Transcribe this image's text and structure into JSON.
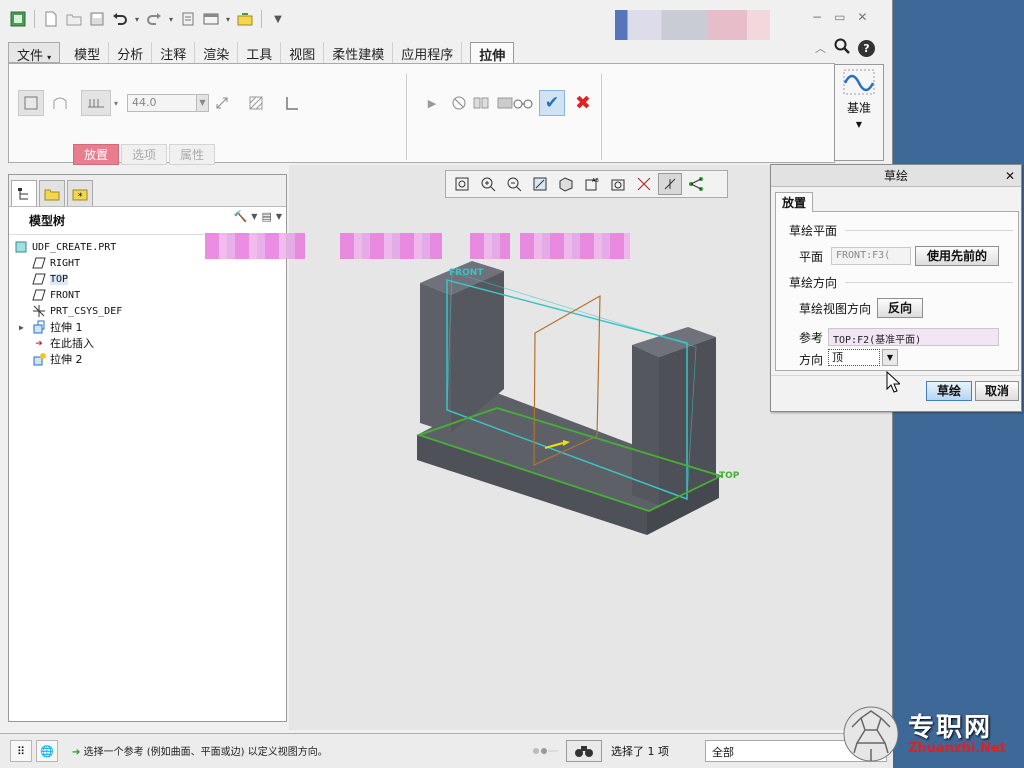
{
  "quick_access": {
    "icons": [
      "app-icon",
      "new-icon",
      "open-icon",
      "save-icon",
      "undo-icon",
      "redo-icon",
      "regenerate-icon",
      "windows-icon",
      "close-icon",
      "customize-icon"
    ]
  },
  "ribbon": {
    "tabs": [
      {
        "label": "文件"
      },
      {
        "label": "模型"
      },
      {
        "label": "分析"
      },
      {
        "label": "注释"
      },
      {
        "label": "渲染"
      },
      {
        "label": "工具"
      },
      {
        "label": "视图"
      },
      {
        "label": "柔性建模"
      },
      {
        "label": "应用程序"
      },
      {
        "label": "拉伸"
      }
    ],
    "active_tab": "拉伸",
    "depth_value": "44.0",
    "subtabs": [
      {
        "label": "放置"
      },
      {
        "label": "选项"
      },
      {
        "label": "属性"
      }
    ],
    "datum_label": "基准"
  },
  "model_tree": {
    "header": "模型树",
    "items": [
      {
        "label": "UDF_CREATE.PRT",
        "icon": "part-icon"
      },
      {
        "label": "RIGHT",
        "icon": "datum-plane-icon"
      },
      {
        "label": "TOP",
        "icon": "datum-plane-icon"
      },
      {
        "label": "FRONT",
        "icon": "datum-plane-icon"
      },
      {
        "label": "PRT_CSYS_DEF",
        "icon": "csys-icon"
      },
      {
        "label": "拉伸 1",
        "icon": "extrude-icon"
      },
      {
        "label": "在此插入",
        "icon": "insert-arrow-icon"
      },
      {
        "label": "拉伸 2",
        "icon": "extrude-new-icon"
      }
    ]
  },
  "viewport": {
    "labels": {
      "front": "FRONT",
      "top": "TOP"
    }
  },
  "sketch_dialog": {
    "title": "草绘",
    "tab": "放置",
    "plane_group": "草绘平面",
    "plane_label": "平面",
    "plane_value": "FRONT:F3(",
    "use_previous_button": "使用先前的",
    "orientation_group": "草绘方向",
    "view_direction_label": "草绘视图方向",
    "flip_button": "反向",
    "reference_label": "参考",
    "reference_value": "TOP:F2(基准平面)",
    "direction_label": "方向",
    "direction_value": "顶",
    "sketch_button": "草绘",
    "cancel_button": "取消"
  },
  "status_bar": {
    "message": "选择一个参考 (例如曲面、平面或边) 以定义视图方向。",
    "selection_count": "选择了 1 项",
    "filter_value": "全部"
  },
  "watermark": {
    "cn": "专职网",
    "en": "Zhuanzhi.Net"
  },
  "colors": {
    "accent_subtab": "#e87d8e",
    "confirm": "#2d6fb8",
    "cancel": "#dd2222",
    "desktop": "#3e6898"
  }
}
